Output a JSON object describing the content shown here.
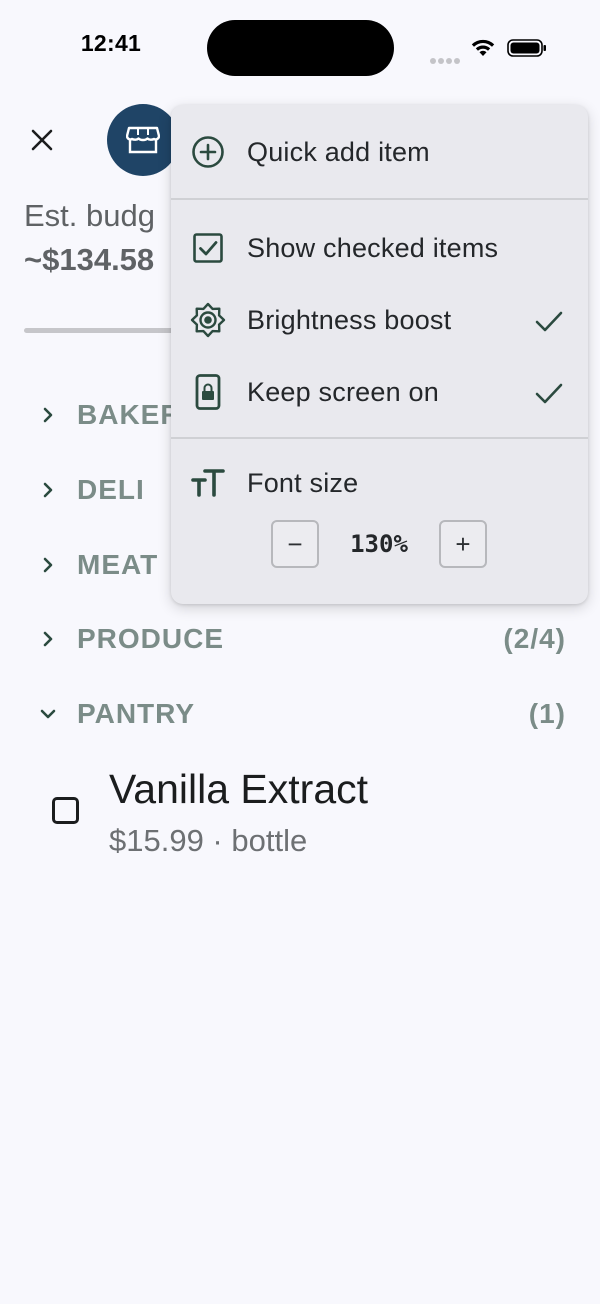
{
  "status_bar": {
    "time": "12:41"
  },
  "header": {
    "close_icon": "close-icon",
    "store_icon": "storefront-icon",
    "budget_label": "Est. budg",
    "budget_value": "~$134.58"
  },
  "categories": [
    {
      "name": "BAKER",
      "count": "",
      "expanded": false
    },
    {
      "name": "DELI",
      "count": "",
      "expanded": false
    },
    {
      "name": "MEAT",
      "count": "",
      "expanded": false
    },
    {
      "name": "PRODUCE",
      "count": "(2/4)",
      "expanded": false
    },
    {
      "name": "PANTRY",
      "count": "(1)",
      "expanded": true
    }
  ],
  "items": [
    {
      "name": "Vanilla Extract",
      "meta": "$15.99 · bottle",
      "checked": false
    }
  ],
  "menu": {
    "quick_add": {
      "label": "Quick add item",
      "icon": "plus-circle-icon"
    },
    "show_checked": {
      "label": "Show checked items",
      "icon": "checkbox-icon",
      "checked": false
    },
    "brightness": {
      "label": "Brightness boost",
      "icon": "brightness-icon",
      "checked": true
    },
    "keep_screen": {
      "label": "Keep screen on",
      "icon": "phone-lock-icon",
      "checked": true
    },
    "font_size": {
      "label": "Font size",
      "icon": "text-size-icon",
      "decrease_label": "−",
      "increase_label": "+",
      "zoom_value": "130%"
    }
  },
  "colors": {
    "background": "#f8f8fd",
    "accent": "#1f4466",
    "icon": "#2b4a3f",
    "menu_background": "#e9e9ee"
  }
}
